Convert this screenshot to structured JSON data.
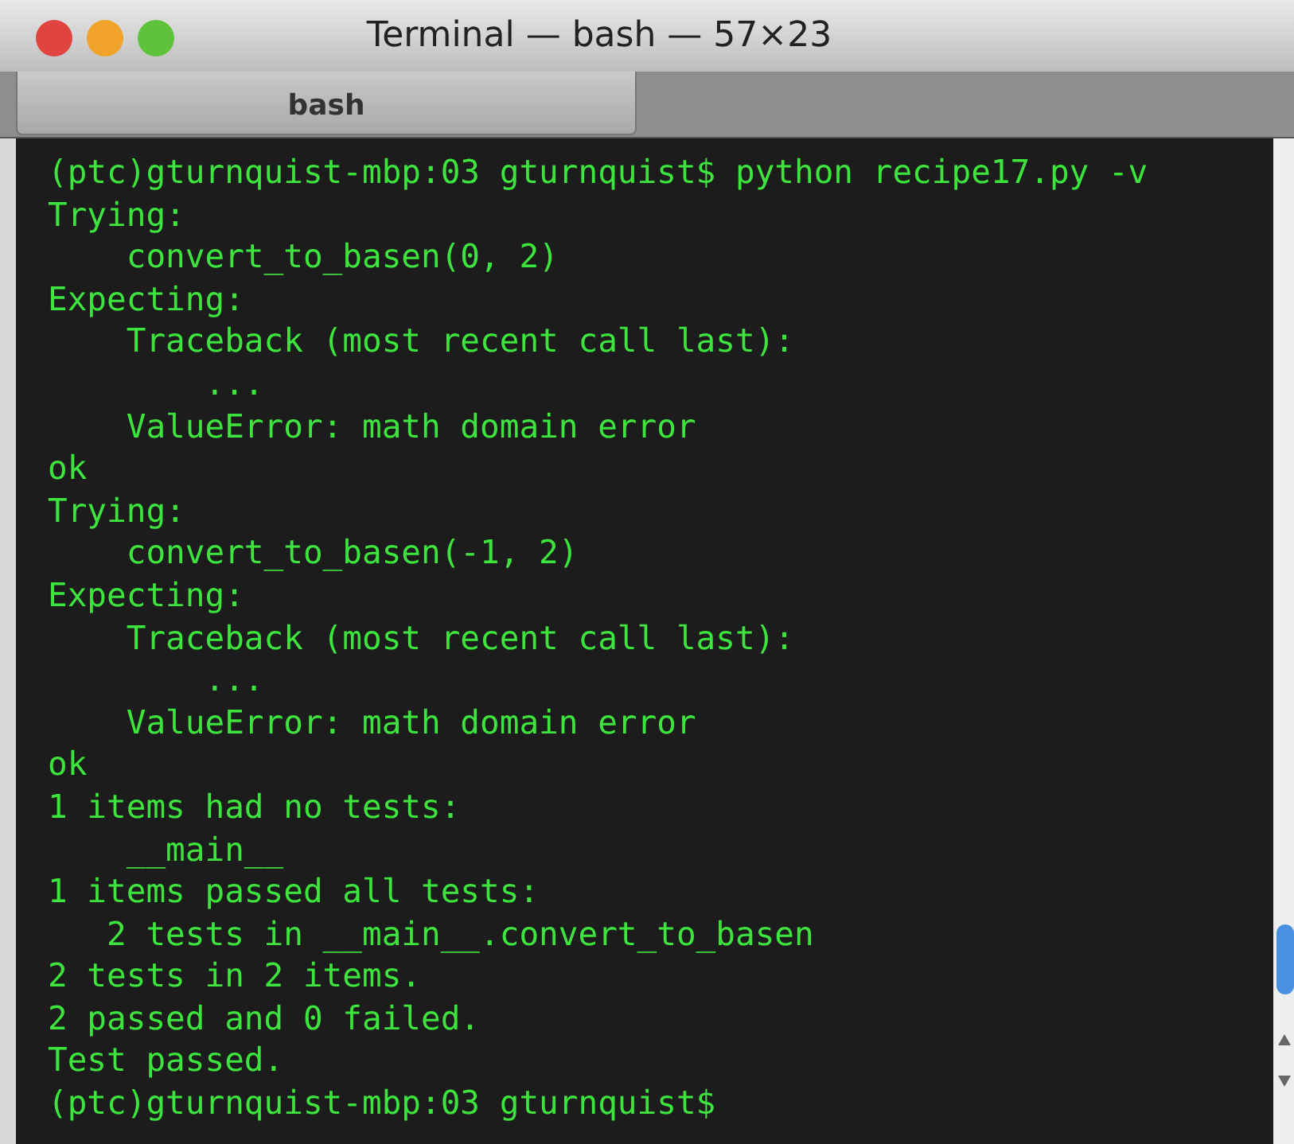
{
  "window": {
    "title": "Terminal — bash — 57×23"
  },
  "tabs": [
    {
      "label": "bash",
      "selected": true
    }
  ],
  "terminal": {
    "lines": [
      "(ptc)gturnquist-mbp:03 gturnquist$ python recipe17.py -v",
      "Trying:",
      "    convert_to_basen(0, 2)",
      "Expecting:",
      "    Traceback (most recent call last):",
      "        ...",
      "    ValueError: math domain error",
      "ok",
      "Trying:",
      "    convert_to_basen(-1, 2)",
      "Expecting:",
      "    Traceback (most recent call last):",
      "        ...",
      "    ValueError: math domain error",
      "ok",
      "1 items had no tests:",
      "    __main__",
      "1 items passed all tests:",
      "   2 tests in __main__.convert_to_basen",
      "2 tests in 2 items.",
      "2 passed and 0 failed.",
      "Test passed.",
      "(ptc)gturnquist-mbp:03 gturnquist$"
    ]
  }
}
